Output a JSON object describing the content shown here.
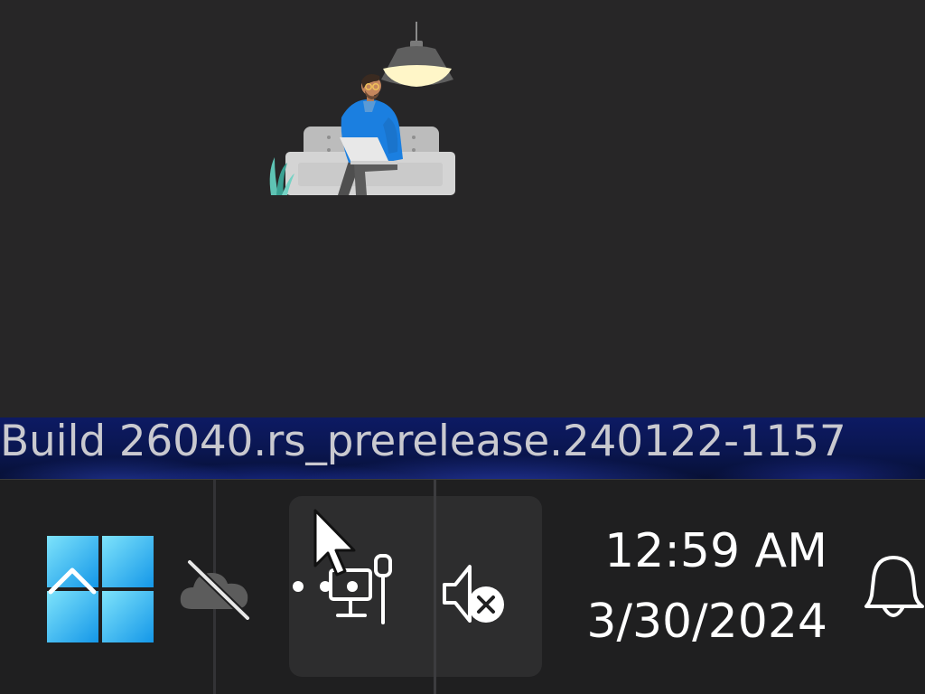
{
  "watermark": {
    "build_string": "Build 26040.rs_prerelease.240122-1157"
  },
  "illustration": {
    "subject": "person-on-couch-with-laptop-illustration"
  },
  "taskbar": {
    "start": {
      "icon": "windows-logo-icon",
      "chevron": "chevron-up-icon"
    },
    "tray": {
      "onedrive": {
        "icon": "onedrive-offline-icon"
      },
      "network": {
        "icon": "ethernet-network-icon"
      },
      "volume": {
        "icon": "volume-muted-icon"
      }
    },
    "clock": {
      "time": "12:59 AM",
      "date": "3/30/2024"
    },
    "notifications": {
      "icon": "bell-icon"
    }
  },
  "colors": {
    "panel_bg": "#272627",
    "taskbar_bg": "#1f1f20",
    "tray_group_bg": "#2d2d2e",
    "start_accent": "#3fb6f5",
    "shirt_blue": "#1b7fe0",
    "lamp_yellow": "#fff6c8"
  }
}
